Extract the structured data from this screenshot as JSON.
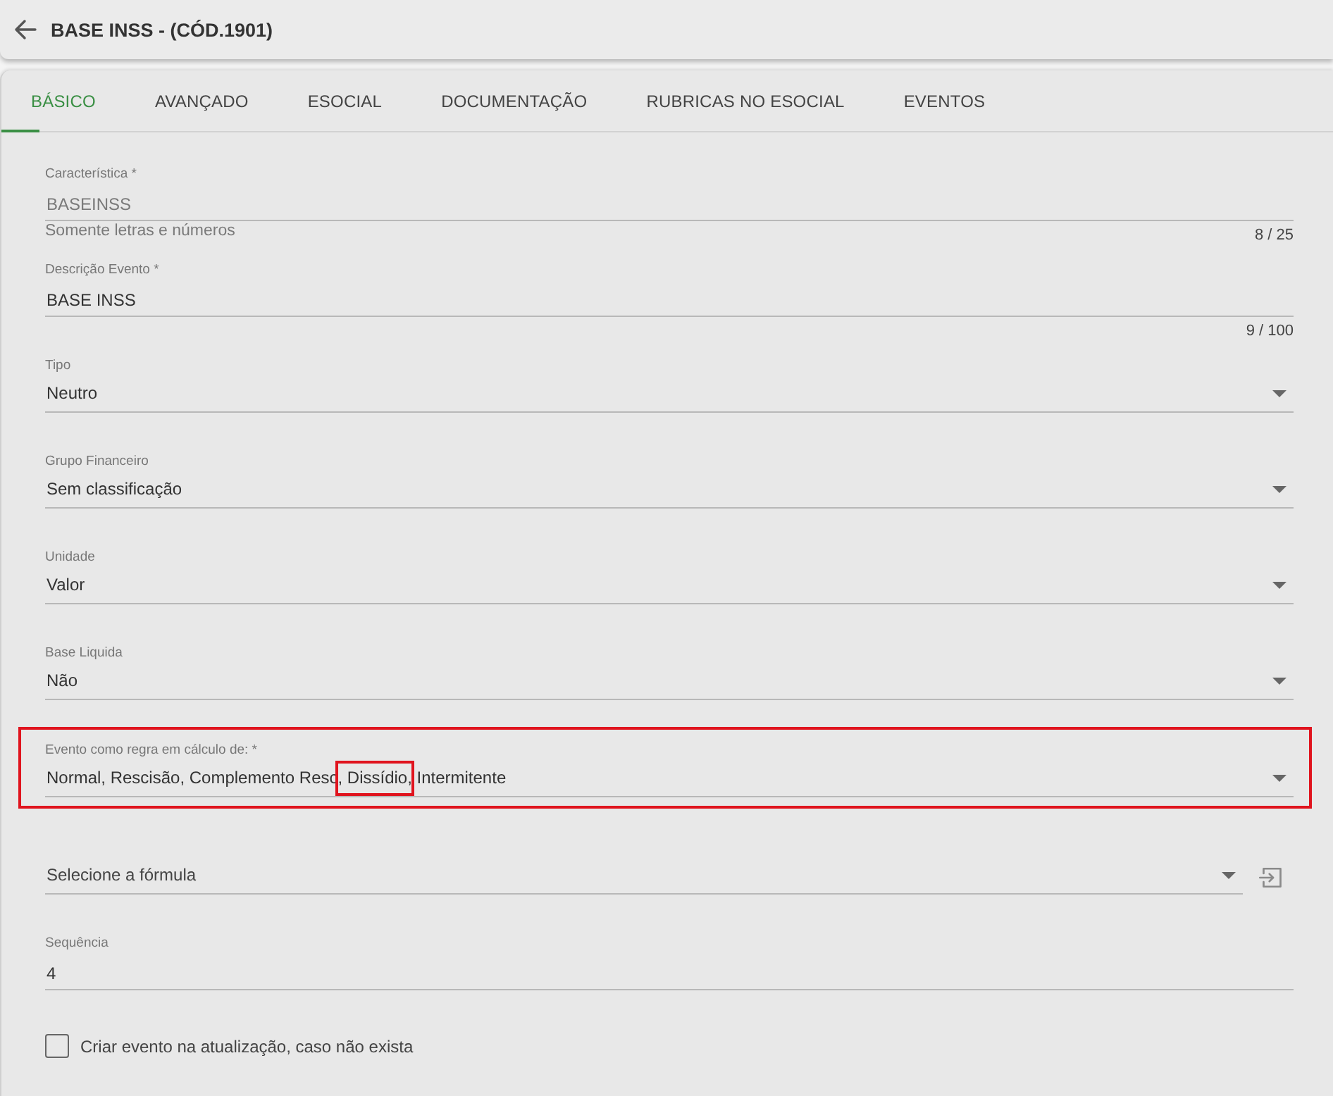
{
  "header": {
    "title": "BASE INSS - (CÓD.1901)"
  },
  "tabs": [
    {
      "label": "BÁSICO",
      "selected": true
    },
    {
      "label": "AVANÇADO",
      "selected": false
    },
    {
      "label": "ESOCIAL",
      "selected": false
    },
    {
      "label": "DOCUMENTAÇÃO",
      "selected": false
    },
    {
      "label": "RUBRICAS NO ESOCIAL",
      "selected": false
    },
    {
      "label": "EVENTOS",
      "selected": false
    }
  ],
  "fields": [
    {
      "kind": "text",
      "label": "Característica *",
      "value": "BASEINSS",
      "disabled": true,
      "hint": "Somente letras e números",
      "counter": "8 / 25",
      "highlighted": false
    },
    {
      "kind": "text",
      "label": "Descrição Evento *",
      "value": "BASE INSS",
      "disabled": false,
      "counter": "9 / 100",
      "highlighted": false
    },
    {
      "kind": "select",
      "label": "Tipo",
      "value_parts": [
        {
          "text": "Neutro",
          "highlighted": false
        }
      ],
      "highlighted": false
    },
    {
      "kind": "select",
      "label": "Grupo Financeiro",
      "value_parts": [
        {
          "text": "Sem classificação",
          "highlighted": false
        }
      ],
      "highlighted": false
    },
    {
      "kind": "select",
      "label": "Unidade",
      "value_parts": [
        {
          "text": "Valor",
          "highlighted": false
        }
      ],
      "highlighted": false
    },
    {
      "kind": "select",
      "label": "Base Liquida",
      "value_parts": [
        {
          "text": "Não",
          "highlighted": false
        }
      ],
      "highlighted": false
    },
    {
      "kind": "select",
      "label": "Evento como regra em cálculo de: *",
      "value_parts": [
        {
          "text": "Normal, Rescisão, Complemento Resc",
          "highlighted": false
        },
        {
          "text": ", Dissídio,",
          "highlighted": true
        },
        {
          "text": " Intermitente",
          "highlighted": false
        }
      ],
      "highlighted": true
    },
    {
      "kind": "formula",
      "placeholder": "Selecione a fórmula",
      "highlighted": false
    },
    {
      "kind": "text",
      "label": "Sequência",
      "value": "4",
      "disabled": false,
      "highlighted": false
    },
    {
      "kind": "checkbox",
      "label": "Criar evento na atualização, caso não exista",
      "checked": false,
      "highlighted": false
    }
  ]
}
